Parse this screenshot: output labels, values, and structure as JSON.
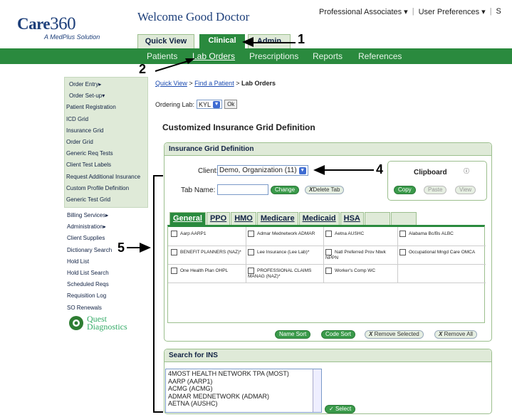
{
  "brand": {
    "logo_text": "Care",
    "logo_num": "360",
    "logo_sub": "A MedPlus Solution"
  },
  "welcome": "Welcome Good Doctor",
  "top_menu": [
    {
      "label": "Professional Associates"
    },
    {
      "label": "User Preferences"
    },
    {
      "label": "S"
    }
  ],
  "main_tabs": {
    "quick_view": "Quick View",
    "clinical": "Clinical",
    "admin": "Admin"
  },
  "nav": [
    "Patients",
    "Lab Orders",
    "Prescriptions",
    "Reports",
    "References"
  ],
  "sidebar": {
    "group1": [
      "Order Entry▸",
      "Order Set-up▾",
      "Patient Registration",
      "ICD Grid",
      "Insurance Grid",
      "Order Grid",
      "Generic Req Tests",
      "Client Test Labels",
      "Request Additional Insurance",
      "Custom Profile Definition",
      "Generic Test Grid"
    ],
    "group2": [
      "Billing Services▸",
      "Administration▸",
      "Client Supplies",
      "Dictionary Search",
      "Hold List",
      "Hold List Search",
      "Scheduled Reqs",
      "Requisition Log",
      "SO Renewals"
    ],
    "quest": {
      "line1": "Quest",
      "line2": "Diagnostics"
    }
  },
  "breadcrumb": {
    "quick_view": "Quick View",
    "find_patient": "Find a Patient",
    "current": "Lab Orders",
    "sep": ">"
  },
  "ordering_lab": {
    "label": "Ordering Lab:",
    "value": "KYL",
    "ok": "Ok"
  },
  "page_title": "Customized Insurance Grid Definition",
  "grid_panel": {
    "title": "Insurance Grid Definition",
    "client_label": "Client:",
    "client_value": "Demo, Organization (11)",
    "tab_name_label": "Tab Name:",
    "change_btn": "Change",
    "delete_tab_btn": "Delete Tab",
    "clipboard": {
      "title": "Clipboard",
      "copy": "Copy",
      "paste": "Paste",
      "view": "View"
    },
    "tabs": [
      "General",
      "PPO",
      "HMO",
      "Medicare",
      "Medicaid",
      "HSA"
    ],
    "cells": [
      "Aarp AARP1",
      "Admar Mednetwork ADMAR",
      "Aetna AUSHC",
      "Alabama Bc/Bs ALBC",
      "BENEFIT PLANNERS (NAZ)*",
      "Lee Insurance (Lee Lab)*",
      "Natl Preferred Prov Ntwk NPPN",
      "Occupational Mngd Care OMCA",
      "One Health Plan OHPL",
      "PROFESSIONAL CLAIMS MANAG (NAZ)*",
      "Worker's Comp WC",
      ""
    ],
    "buttons": {
      "name_sort": "Name Sort",
      "code_sort": "Code Sort",
      "remove_selected": "Remove Selected",
      "remove_all": "Remove All"
    }
  },
  "search_panel": {
    "title": "Search for INS",
    "options": [
      "4MOST HEALTH NETWORK TPA (MOST)",
      "AARP (AARP1)",
      "ACMG (ACMG)",
      "ADMAR MEDNETWORK (ADMAR)",
      "AETNA (AUSHC)"
    ],
    "select_btn": "Select"
  },
  "callouts": [
    "1",
    "2",
    "4",
    "5"
  ]
}
